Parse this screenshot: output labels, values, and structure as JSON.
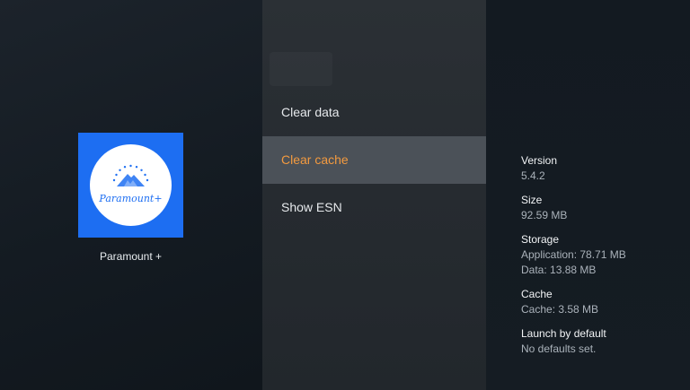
{
  "app": {
    "name": "Paramount +",
    "logo_text": "Paramount+",
    "tile_color": "#1d6ef2"
  },
  "menu": {
    "items": [
      {
        "label": "Clear data"
      },
      {
        "label": "Clear cache"
      },
      {
        "label": "Show ESN"
      }
    ],
    "selected_index": 1,
    "selected_color": "#f39a3f"
  },
  "info": {
    "version": {
      "title": "Version",
      "value": "5.4.2"
    },
    "size": {
      "title": "Size",
      "value": "92.59 MB"
    },
    "storage": {
      "title": "Storage",
      "application": "Application: 78.71 MB",
      "data": "Data: 13.88 MB"
    },
    "cache": {
      "title": "Cache",
      "value": "Cache: 3.58 MB"
    },
    "launch": {
      "title": "Launch by default",
      "value": "No defaults set."
    }
  }
}
